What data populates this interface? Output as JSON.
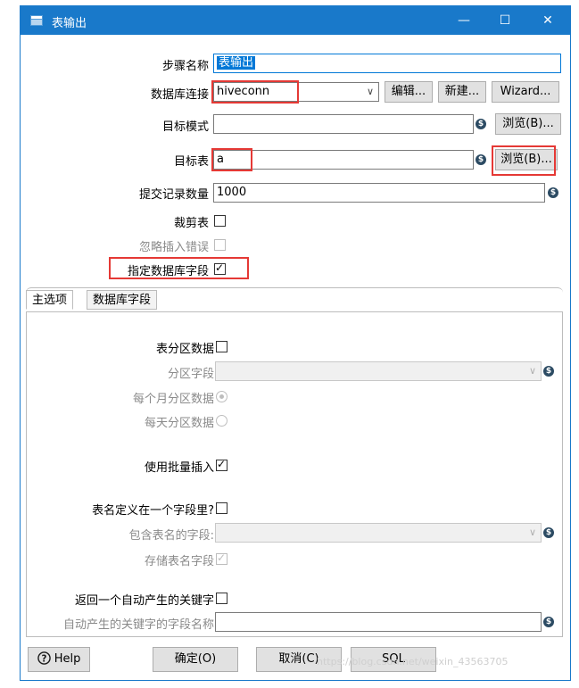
{
  "window": {
    "title": "表输出",
    "controls": {
      "minimize": "—",
      "maximize": "☐",
      "close": "✕"
    }
  },
  "form": {
    "step_name": {
      "label": "步骤名称",
      "value": "表输出"
    },
    "connection": {
      "label": "数据库连接",
      "value": "hiveconn",
      "edit": "编辑...",
      "new": "新建...",
      "wizard": "Wizard..."
    },
    "target_schema": {
      "label": "目标模式",
      "value": "",
      "browse": "浏览(B)..."
    },
    "target_table": {
      "label": "目标表",
      "value": "a",
      "browse": "浏览(B)..."
    },
    "commit_size": {
      "label": "提交记录数量",
      "value": "1000"
    },
    "truncate": {
      "label": "裁剪表",
      "checked": false
    },
    "ignore_errors": {
      "label": "忽略插入错误",
      "checked": false,
      "disabled": true
    },
    "specify_fields": {
      "label": "指定数据库字段",
      "checked": true
    }
  },
  "tabs": [
    {
      "label": "主选项",
      "active": true
    },
    {
      "label": "数据库字段",
      "active": false
    }
  ],
  "main_options": {
    "partition": {
      "label": "表分区数据",
      "checked": false
    },
    "partition_field": {
      "label": "分区字段",
      "value": ""
    },
    "monthly": {
      "label": "每个月分区数据",
      "selected": true
    },
    "daily": {
      "label": "每天分区数据",
      "selected": false
    },
    "batch_insert": {
      "label": "使用批量插入",
      "checked": true
    },
    "table_in_field": {
      "label": "表名定义在一个字段里?",
      "checked": false
    },
    "table_field": {
      "label": "包含表名的字段:",
      "value": ""
    },
    "store_table_field": {
      "label": "存储表名字段",
      "checked": true
    },
    "return_key": {
      "label": "返回一个自动产生的关键字",
      "checked": false
    },
    "key_field": {
      "label": "自动产生的关键字的字段名称",
      "value": ""
    }
  },
  "footer": {
    "help": "Help",
    "ok": "确定(O)",
    "cancel": "取消(C)",
    "sql": "SQL"
  },
  "watermark": "https://blog.csdn.net/weixin_43563705",
  "colors": {
    "titlebar": "#1979ca",
    "highlight": "#e53935",
    "variable_icon": "#2c4b63"
  },
  "icons": {
    "variable": "dollar-diamond-icon",
    "help": "question-circle-icon"
  }
}
